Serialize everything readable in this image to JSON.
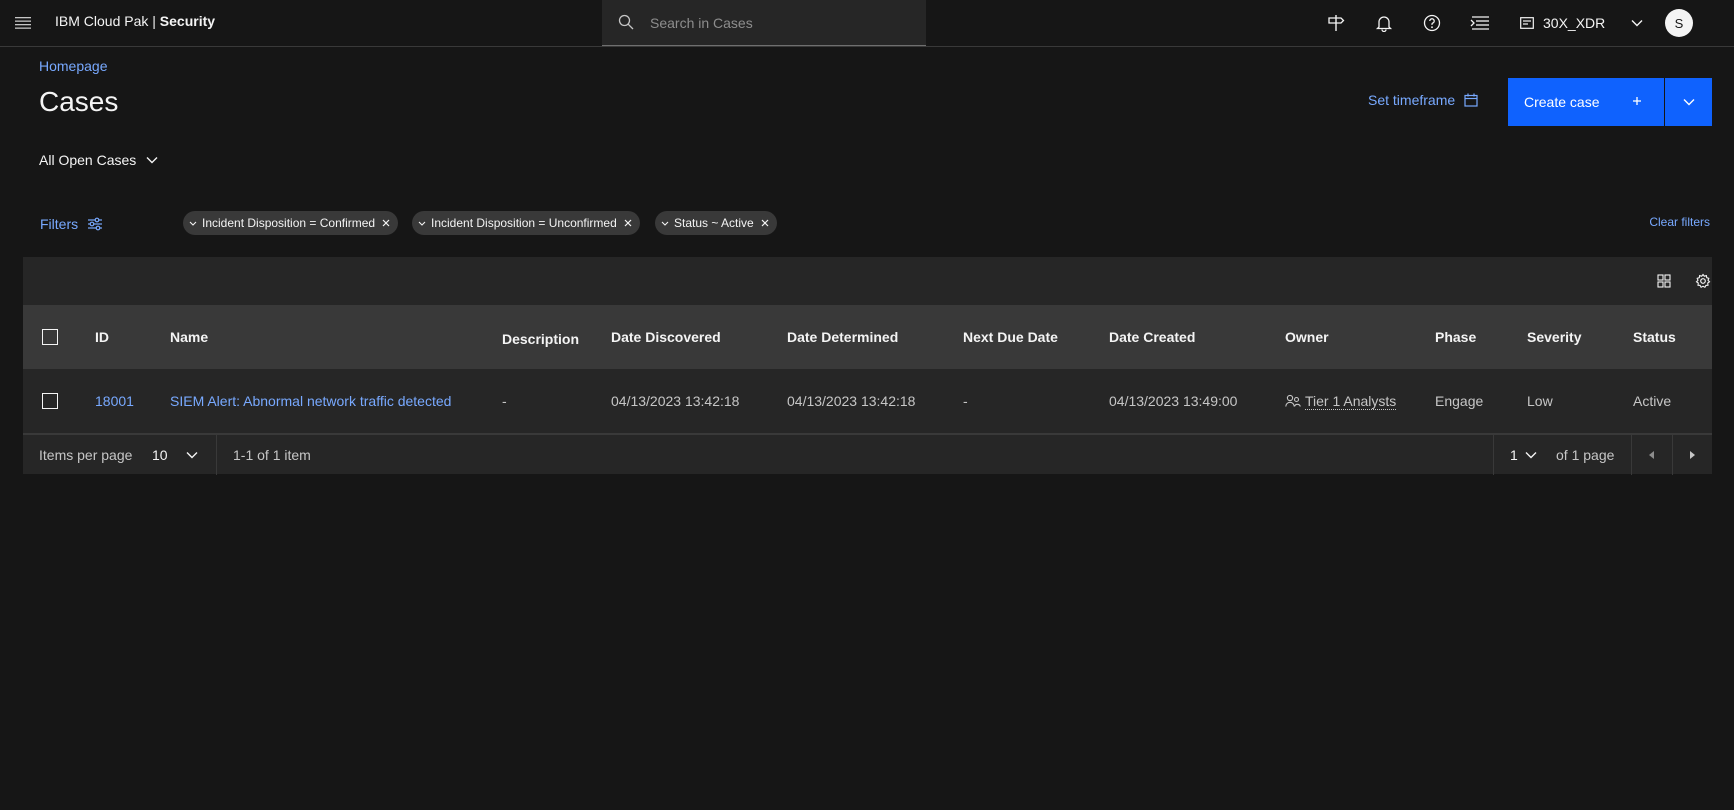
{
  "header": {
    "brand_prefix": "IBM Cloud Pak | ",
    "brand_product": "Security",
    "search_placeholder": "Search in Cases",
    "tenant_label": "30X_XDR",
    "avatar_initial": "S"
  },
  "page": {
    "breadcrumb": "Homepage",
    "title": "Cases",
    "set_timeframe": "Set timeframe",
    "create_case": "Create case",
    "view_select": "All Open Cases"
  },
  "filters": {
    "label": "Filters",
    "tags": [
      "Incident Disposition = Confirmed",
      "Incident Disposition = Unconfirmed",
      "Status ~ Active"
    ],
    "clear": "Clear filters"
  },
  "table": {
    "columns": {
      "id": "ID",
      "name": "Name",
      "description": "Description",
      "date_discovered": "Date Discovered",
      "date_determined": "Date Determined",
      "next_due_date": "Next Due Date",
      "date_created": "Date Created",
      "owner": "Owner",
      "phase": "Phase",
      "severity": "Severity",
      "status": "Status"
    },
    "rows": [
      {
        "id": "18001",
        "name": "SIEM Alert: Abnormal network traffic detected",
        "description": "-",
        "date_discovered": "04/13/2023 13:42:18",
        "date_determined": "04/13/2023 13:42:18",
        "next_due_date": "-",
        "date_created": "04/13/2023 13:49:00",
        "owner": "Tier 1 Analysts",
        "phase": "Engage",
        "severity": "Low",
        "status": "Active"
      }
    ]
  },
  "pagination": {
    "items_per_page_label": "Items per page",
    "items_per_page": "10",
    "range": "1-1 of 1 item",
    "page": "1",
    "of_pages": "of 1 page"
  },
  "colors": {
    "background": "#161616",
    "accent": "#0f62fe",
    "link": "#78a9ff"
  }
}
